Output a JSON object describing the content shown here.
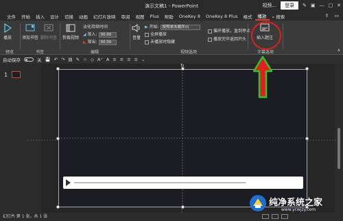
{
  "window": {
    "title": "演示文稿1 - PowerPoint",
    "video_label": "视频...",
    "login_label": "登录",
    "minimize": "—",
    "restore": "□",
    "close": "✕"
  },
  "tabs": [
    "文件",
    "开始",
    "插入",
    "设计",
    "切换",
    "动画",
    "幻灯片放映",
    "审阅",
    "视图",
    "Plus",
    "帮助",
    "OneKey 8",
    "OneKey 8 Plus",
    "格式",
    "播放"
  ],
  "active_tab": "播放",
  "search_label": "搜索",
  "ribbon": {
    "preview": {
      "play_label": "播放",
      "group": "预览"
    },
    "bookmarks": {
      "add_label": "添加书签",
      "remove_label": "删除书签",
      "group": "书签"
    },
    "editing": {
      "trim_label": "剪裁视频",
      "fade_label": "淡化持续时间",
      "fade_in_label": "渐入:",
      "fade_in_value": "00.00",
      "fade_out_label": "渐出:",
      "fade_out_value": "00.00",
      "group": "编辑"
    },
    "video_options": {
      "volume_label": "音量",
      "start_label": "开始:",
      "start_value": "按照单击顺序(I)",
      "fullscreen_label": "全屏播放",
      "hide_label": "未播放时隐藏",
      "loop_label": "循环播放，直到停止",
      "rewind_label": "播放完毕返回开头",
      "group": "视频选项"
    },
    "captions": {
      "insert_label": "插入题注",
      "group": "字幕选项"
    }
  },
  "qat": {
    "autosave_label": "自动保存",
    "autosave_state": "关"
  },
  "slide_panel": {
    "slide_number": "1"
  },
  "status": {
    "text": "幻灯片 第 1 张，共 1 张"
  },
  "watermark": {
    "text": "纯净系统之家",
    "url": "www.ycwjzy.com"
  },
  "colors": {
    "accent": "#d24726",
    "annotation_red": "#e0201b",
    "annotation_green": "#2fc32f"
  }
}
